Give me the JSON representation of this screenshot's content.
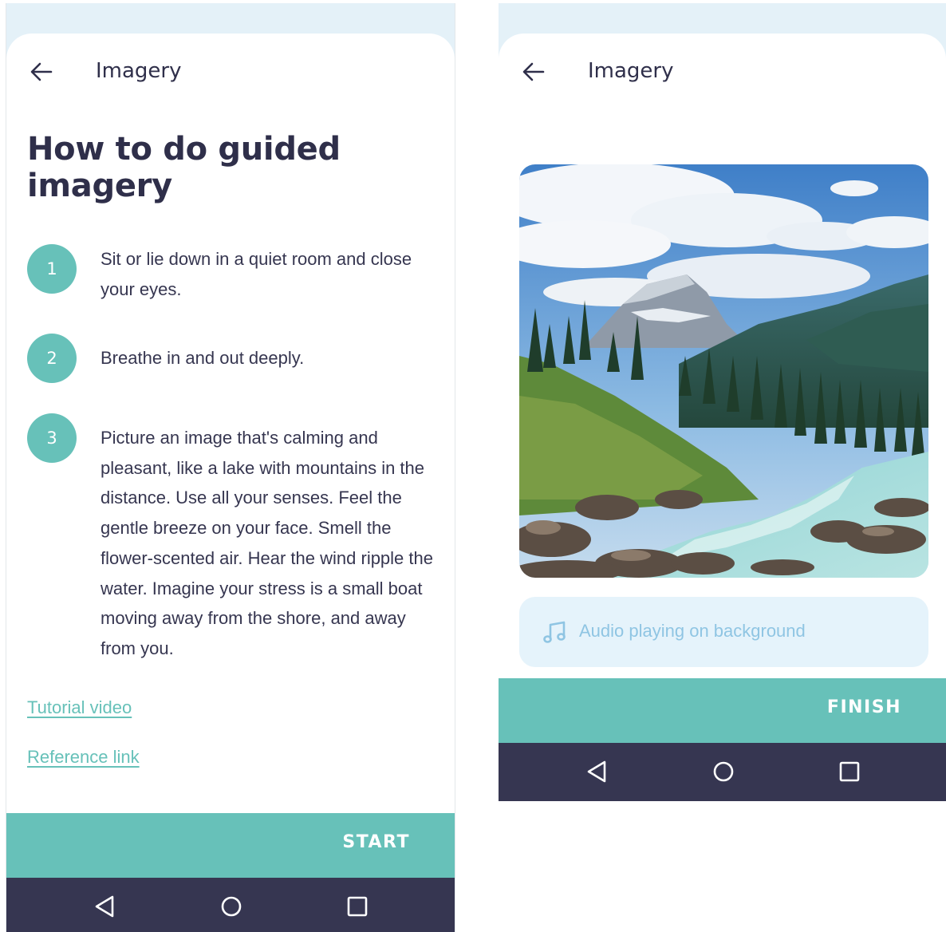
{
  "left_screen": {
    "appbar": {
      "title": "Imagery",
      "back_icon": "arrow-left-icon"
    },
    "headline": "How to do guided imagery",
    "steps": [
      {
        "number": "1",
        "text": "Sit or lie down in a quiet room and close your eyes."
      },
      {
        "number": "2",
        "text": "Breathe in and out deeply."
      },
      {
        "number": "3",
        "text": "Picture an image that's calming and pleasant, like a lake with mountains in the distance. Use all your senses. Feel the gentle breeze on your face. Smell the flower-scented air. Hear the wind ripple the water. Imagine your stress is a small boat moving away from the shore, and away from you."
      }
    ],
    "links": {
      "tutorial": "Tutorial video",
      "reference": "Reference link"
    },
    "action_label": "START"
  },
  "right_screen": {
    "appbar": {
      "title": "Imagery",
      "back_icon": "arrow-left-icon"
    },
    "image": "mountain-river-landscape",
    "audio": {
      "icon": "music-note-icon",
      "text": "Audio playing on background"
    },
    "action_label": "FINISH"
  },
  "nav_icons": [
    "triangle-back-icon",
    "circle-home-icon",
    "square-recents-icon"
  ],
  "colors": {
    "accent": "#67c1b9",
    "navbar": "#363651",
    "text": "#2f2f4a",
    "audio_bg": "#e5f3fb",
    "audio_text": "#8fc5e3",
    "status_bg": "#e4f1f8"
  }
}
